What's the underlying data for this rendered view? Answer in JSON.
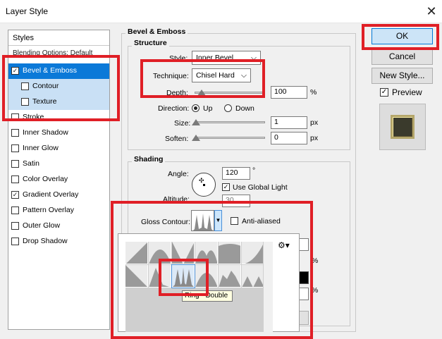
{
  "window": {
    "title": "Layer Style",
    "close_glyph": "✕"
  },
  "styles_panel": {
    "header": "Styles",
    "blending_options": "Blending Options: Default",
    "items": [
      {
        "label": "Bevel & Emboss",
        "checked": true,
        "selected": true
      },
      {
        "label": "Contour",
        "checked": false,
        "sub": true
      },
      {
        "label": "Texture",
        "checked": false,
        "sub": true
      },
      {
        "label": "Stroke",
        "checked": false
      },
      {
        "label": "Inner Shadow",
        "checked": false
      },
      {
        "label": "Inner Glow",
        "checked": false
      },
      {
        "label": "Satin",
        "checked": false
      },
      {
        "label": "Color Overlay",
        "checked": false
      },
      {
        "label": "Gradient Overlay",
        "checked": true
      },
      {
        "label": "Pattern Overlay",
        "checked": false
      },
      {
        "label": "Outer Glow",
        "checked": false
      },
      {
        "label": "Drop Shadow",
        "checked": false
      }
    ]
  },
  "bevel": {
    "group_title": "Bevel & Emboss",
    "structure_title": "Structure",
    "style_label": "Style:",
    "style_value": "Inner Bevel",
    "technique_label": "Technique:",
    "technique_value": "Chisel Hard",
    "depth_label": "Depth:",
    "depth_value": "100",
    "depth_unit": "%",
    "direction_label": "Direction:",
    "dir_up": "Up",
    "dir_down": "Down",
    "size_label": "Size:",
    "size_value": "1",
    "size_unit": "px",
    "soften_label": "Soften:",
    "soften_value": "0",
    "soften_unit": "px"
  },
  "shading": {
    "title": "Shading",
    "angle_label": "Angle:",
    "angle_value": "120",
    "degree": "°",
    "use_global_light": "Use Global Light",
    "altitude_label": "Altitude:",
    "altitude_value": "30",
    "gloss_contour_label": "Gloss Contour:",
    "anti_aliased": "Anti-aliased",
    "percent": "%"
  },
  "buttons": {
    "ok": "OK",
    "cancel": "Cancel",
    "new_style": "New Style...",
    "preview": "Preview"
  },
  "contour_picker": {
    "tooltip": "Ring - Double",
    "gear_glyph": "⚙▾"
  },
  "colors": {
    "selection": "#0b79d8",
    "annotation_red": "#e01f26",
    "preview_swatch": "#3a3a2c"
  }
}
